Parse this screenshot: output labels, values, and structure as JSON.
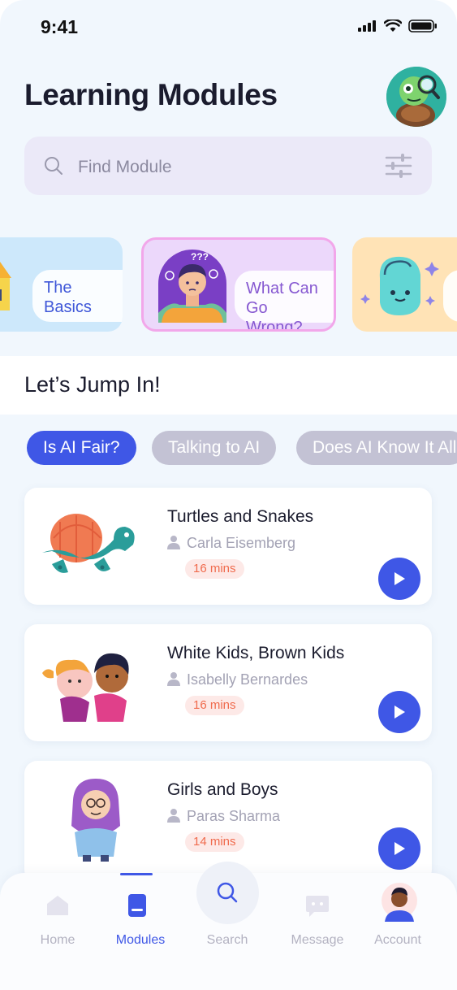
{
  "status": {
    "time": "9:41"
  },
  "header": {
    "title": "Learning Modules"
  },
  "search": {
    "placeholder": "Find Module"
  },
  "modules": [
    {
      "label_line1": "The",
      "label_line2": "Basics"
    },
    {
      "label_line1": "What Can",
      "label_line2": "Go Wrong?",
      "badge": "???"
    }
  ],
  "section": {
    "title": "Let’s Jump In!"
  },
  "chips": [
    {
      "label": "Is AI Fair?",
      "active": true
    },
    {
      "label": "Talking to AI",
      "active": false
    },
    {
      "label": "Does AI Know It All",
      "active": false
    }
  ],
  "courses": [
    {
      "title": "Turtles and Snakes",
      "author": "Carla Eisemberg",
      "duration": "16 mins"
    },
    {
      "title": "White Kids, Brown Kids",
      "author": "Isabelly Bernardes",
      "duration": "16 mins"
    },
    {
      "title": "Girls and Boys",
      "author": "Paras Sharma",
      "duration": "14 mins"
    }
  ],
  "tabs": [
    {
      "label": "Home"
    },
    {
      "label": "Modules"
    },
    {
      "label": "Search"
    },
    {
      "label": "Message"
    },
    {
      "label": "Account"
    }
  ],
  "colors": {
    "accent": "#3f57e6",
    "chip_inactive": "#c3c2d4",
    "background": "#f1f7fd"
  }
}
